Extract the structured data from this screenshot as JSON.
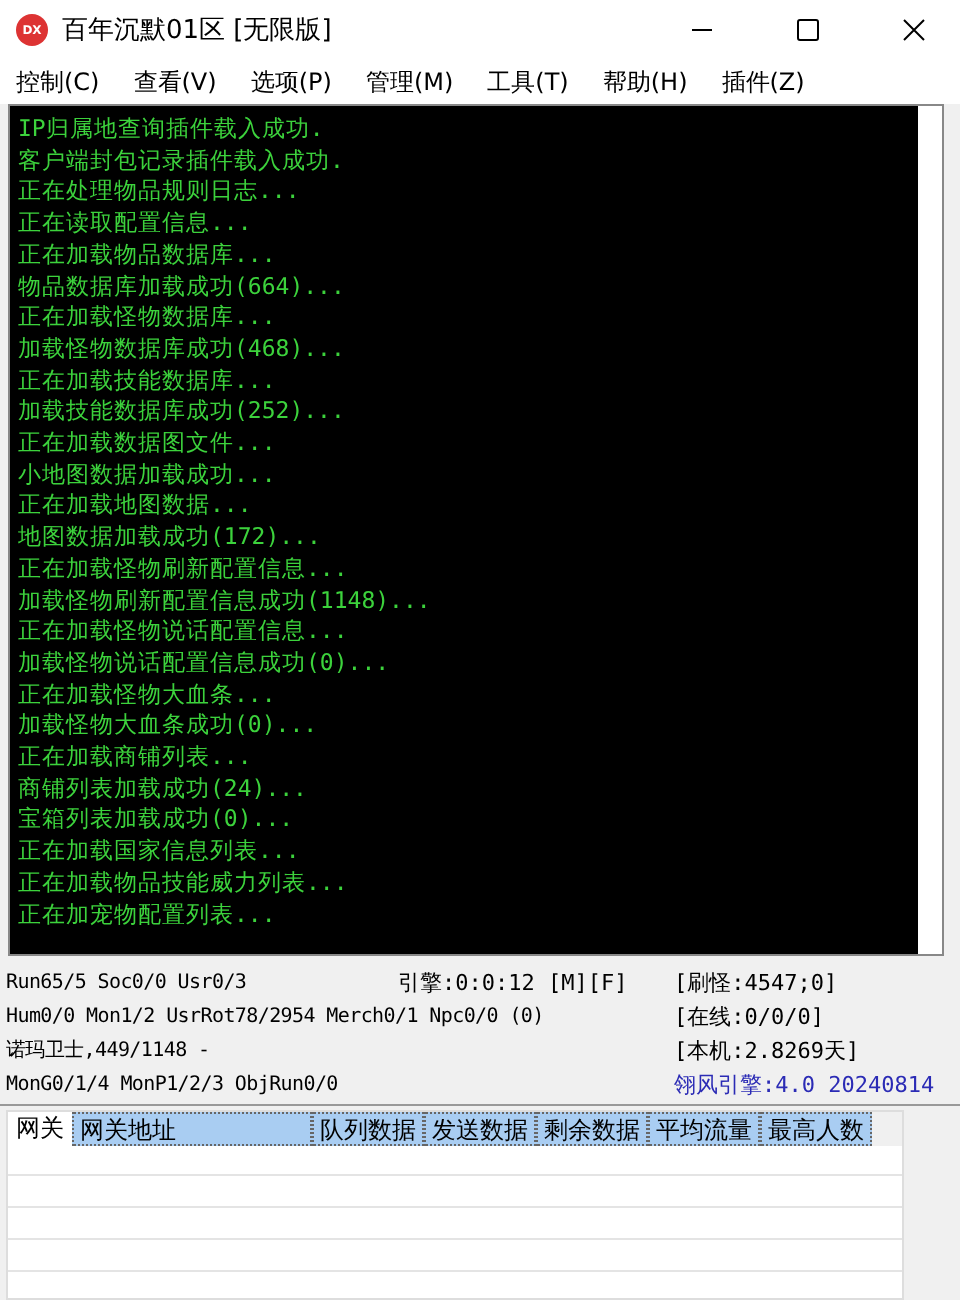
{
  "window": {
    "title": "百年沉默01区 [无限版]",
    "icon_text": "DX"
  },
  "menu": [
    "控制(C)",
    "查看(V)",
    "选项(P)",
    "管理(M)",
    "工具(T)",
    "帮助(H)",
    "插件(Z)"
  ],
  "console": [
    "IP归属地查询插件载入成功.",
    "客户端封包记录插件载入成功.",
    "正在处理物品规则日志...",
    "正在读取配置信息...",
    "正在加载物品数据库...",
    "物品数据库加载成功(664)...",
    "正在加载怪物数据库...",
    "加载怪物数据库成功(468)...",
    "正在加载技能数据库...",
    "加载技能数据库成功(252)...",
    "正在加载数据图文件...",
    "小地图数据加载成功...",
    "正在加载地图数据...",
    "地图数据加载成功(172)...",
    "正在加载怪物刷新配置信息...",
    "加载怪物刷新配置信息成功(1148)...",
    "正在加载怪物说话配置信息...",
    "加载怪物说话配置信息成功(0)...",
    "正在加载怪物大血条...",
    "加载怪物大血条成功(0)...",
    "正在加载商铺列表...",
    "商铺列表加载成功(24)...",
    "宝箱列表加载成功(0)...",
    "正在加载国家信息列表...",
    "正在加载物品技能威力列表...",
    "正在加宠物配置列表..."
  ],
  "status": [
    {
      "left": "Run65/5 Soc0/0 Usr0/3",
      "middle": "引擎:0:0:12 [M][F]",
      "right": "[刷怪:4547;0]",
      "accent": false
    },
    {
      "left": "Hum0/0 Mon1/2 UsrRot78/2954 Merch0/1 Npc0/0 (0)",
      "right": "[在线:0/0/0]",
      "accent": false
    },
    {
      "left": "诺玛卫士,449/1148 -",
      "right": "[本机:2.8269天]",
      "accent": false
    },
    {
      "left": "MonG0/1/4 MonP1/2/3 ObjRun0/0",
      "right": "翎风引擎:4.0 20240814",
      "accent": true
    }
  ],
  "gateway_table": {
    "tab": "网关",
    "columns": [
      {
        "label": "网关地址",
        "selected": true
      },
      {
        "label": "队列数据",
        "selected": true
      },
      {
        "label": "发送数据",
        "selected": true
      },
      {
        "label": "剩余数据",
        "selected": true
      },
      {
        "label": "平均流量",
        "selected": true
      },
      {
        "label": "最高人数",
        "selected": true
      }
    ]
  }
}
